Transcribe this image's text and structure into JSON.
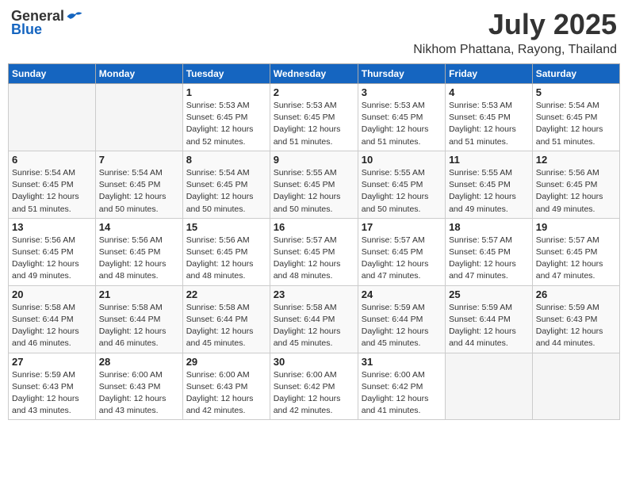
{
  "header": {
    "logo_general": "General",
    "logo_blue": "Blue",
    "title": "July 2025",
    "subtitle": "Nikhom Phattana, Rayong, Thailand"
  },
  "calendar": {
    "days_of_week": [
      "Sunday",
      "Monday",
      "Tuesday",
      "Wednesday",
      "Thursday",
      "Friday",
      "Saturday"
    ],
    "weeks": [
      [
        {
          "day": "",
          "info": ""
        },
        {
          "day": "",
          "info": ""
        },
        {
          "day": "1",
          "info": "Sunrise: 5:53 AM\nSunset: 6:45 PM\nDaylight: 12 hours and 52 minutes."
        },
        {
          "day": "2",
          "info": "Sunrise: 5:53 AM\nSunset: 6:45 PM\nDaylight: 12 hours and 51 minutes."
        },
        {
          "day": "3",
          "info": "Sunrise: 5:53 AM\nSunset: 6:45 PM\nDaylight: 12 hours and 51 minutes."
        },
        {
          "day": "4",
          "info": "Sunrise: 5:53 AM\nSunset: 6:45 PM\nDaylight: 12 hours and 51 minutes."
        },
        {
          "day": "5",
          "info": "Sunrise: 5:54 AM\nSunset: 6:45 PM\nDaylight: 12 hours and 51 minutes."
        }
      ],
      [
        {
          "day": "6",
          "info": "Sunrise: 5:54 AM\nSunset: 6:45 PM\nDaylight: 12 hours and 51 minutes."
        },
        {
          "day": "7",
          "info": "Sunrise: 5:54 AM\nSunset: 6:45 PM\nDaylight: 12 hours and 50 minutes."
        },
        {
          "day": "8",
          "info": "Sunrise: 5:54 AM\nSunset: 6:45 PM\nDaylight: 12 hours and 50 minutes."
        },
        {
          "day": "9",
          "info": "Sunrise: 5:55 AM\nSunset: 6:45 PM\nDaylight: 12 hours and 50 minutes."
        },
        {
          "day": "10",
          "info": "Sunrise: 5:55 AM\nSunset: 6:45 PM\nDaylight: 12 hours and 50 minutes."
        },
        {
          "day": "11",
          "info": "Sunrise: 5:55 AM\nSunset: 6:45 PM\nDaylight: 12 hours and 49 minutes."
        },
        {
          "day": "12",
          "info": "Sunrise: 5:56 AM\nSunset: 6:45 PM\nDaylight: 12 hours and 49 minutes."
        }
      ],
      [
        {
          "day": "13",
          "info": "Sunrise: 5:56 AM\nSunset: 6:45 PM\nDaylight: 12 hours and 49 minutes."
        },
        {
          "day": "14",
          "info": "Sunrise: 5:56 AM\nSunset: 6:45 PM\nDaylight: 12 hours and 48 minutes."
        },
        {
          "day": "15",
          "info": "Sunrise: 5:56 AM\nSunset: 6:45 PM\nDaylight: 12 hours and 48 minutes."
        },
        {
          "day": "16",
          "info": "Sunrise: 5:57 AM\nSunset: 6:45 PM\nDaylight: 12 hours and 48 minutes."
        },
        {
          "day": "17",
          "info": "Sunrise: 5:57 AM\nSunset: 6:45 PM\nDaylight: 12 hours and 47 minutes."
        },
        {
          "day": "18",
          "info": "Sunrise: 5:57 AM\nSunset: 6:45 PM\nDaylight: 12 hours and 47 minutes."
        },
        {
          "day": "19",
          "info": "Sunrise: 5:57 AM\nSunset: 6:45 PM\nDaylight: 12 hours and 47 minutes."
        }
      ],
      [
        {
          "day": "20",
          "info": "Sunrise: 5:58 AM\nSunset: 6:44 PM\nDaylight: 12 hours and 46 minutes."
        },
        {
          "day": "21",
          "info": "Sunrise: 5:58 AM\nSunset: 6:44 PM\nDaylight: 12 hours and 46 minutes."
        },
        {
          "day": "22",
          "info": "Sunrise: 5:58 AM\nSunset: 6:44 PM\nDaylight: 12 hours and 45 minutes."
        },
        {
          "day": "23",
          "info": "Sunrise: 5:58 AM\nSunset: 6:44 PM\nDaylight: 12 hours and 45 minutes."
        },
        {
          "day": "24",
          "info": "Sunrise: 5:59 AM\nSunset: 6:44 PM\nDaylight: 12 hours and 45 minutes."
        },
        {
          "day": "25",
          "info": "Sunrise: 5:59 AM\nSunset: 6:44 PM\nDaylight: 12 hours and 44 minutes."
        },
        {
          "day": "26",
          "info": "Sunrise: 5:59 AM\nSunset: 6:43 PM\nDaylight: 12 hours and 44 minutes."
        }
      ],
      [
        {
          "day": "27",
          "info": "Sunrise: 5:59 AM\nSunset: 6:43 PM\nDaylight: 12 hours and 43 minutes."
        },
        {
          "day": "28",
          "info": "Sunrise: 6:00 AM\nSunset: 6:43 PM\nDaylight: 12 hours and 43 minutes."
        },
        {
          "day": "29",
          "info": "Sunrise: 6:00 AM\nSunset: 6:43 PM\nDaylight: 12 hours and 42 minutes."
        },
        {
          "day": "30",
          "info": "Sunrise: 6:00 AM\nSunset: 6:42 PM\nDaylight: 12 hours and 42 minutes."
        },
        {
          "day": "31",
          "info": "Sunrise: 6:00 AM\nSunset: 6:42 PM\nDaylight: 12 hours and 41 minutes."
        },
        {
          "day": "",
          "info": ""
        },
        {
          "day": "",
          "info": ""
        }
      ]
    ]
  }
}
